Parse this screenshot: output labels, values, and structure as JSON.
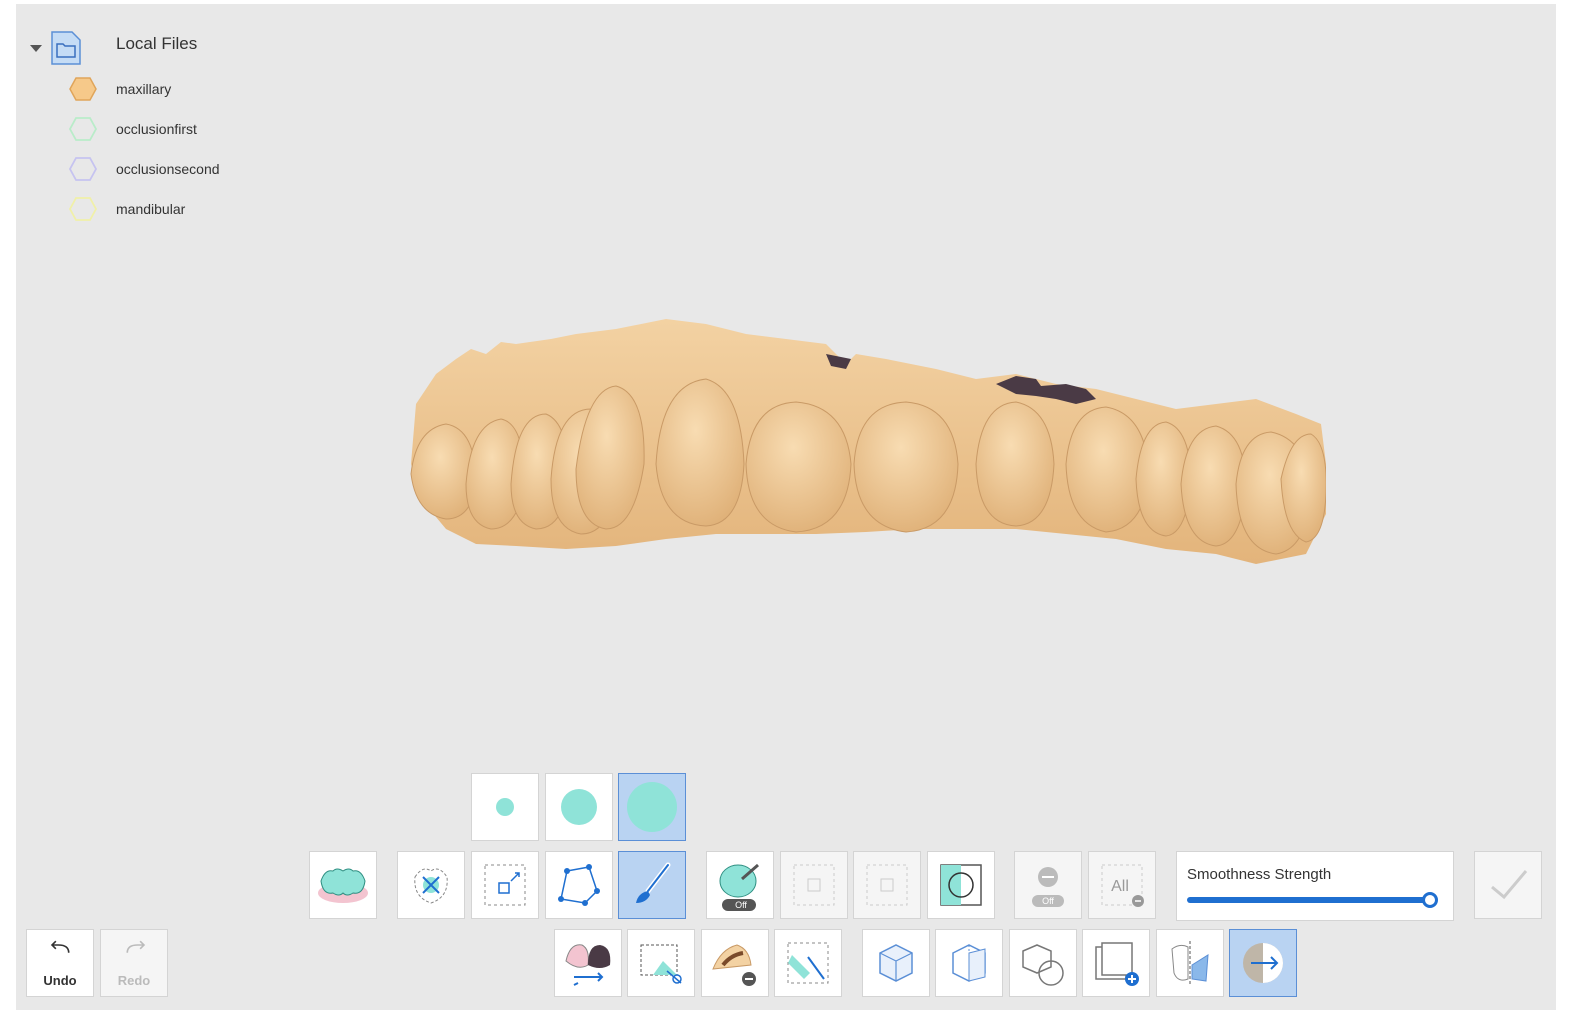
{
  "tree": {
    "root_label": "Local Files",
    "items": [
      {
        "label": "maxillary",
        "color": "#f6c98a",
        "stroke": "#e0a55a",
        "filled": true
      },
      {
        "label": "occlusionfirst",
        "color": "none",
        "stroke": "#b9ecc9",
        "filled": false
      },
      {
        "label": "occlusionsecond",
        "color": "none",
        "stroke": "#c6c3f0",
        "filled": false
      },
      {
        "label": "mandibular",
        "color": "none",
        "stroke": "#f0f0a8",
        "filled": false
      }
    ]
  },
  "brush_sizes": [
    {
      "name": "brush-small",
      "selected": false
    },
    {
      "name": "brush-medium",
      "selected": false
    },
    {
      "name": "brush-large",
      "selected": true
    }
  ],
  "smoothness": {
    "label": "Smoothness Strength",
    "value": 1.0
  },
  "undo_label": "Undo",
  "redo_label": "Redo",
  "colors": {
    "accent": "#1f6fd0",
    "active_bg": "#b9d3f2",
    "model": "#efc995",
    "teal": "#8fe3d8"
  }
}
